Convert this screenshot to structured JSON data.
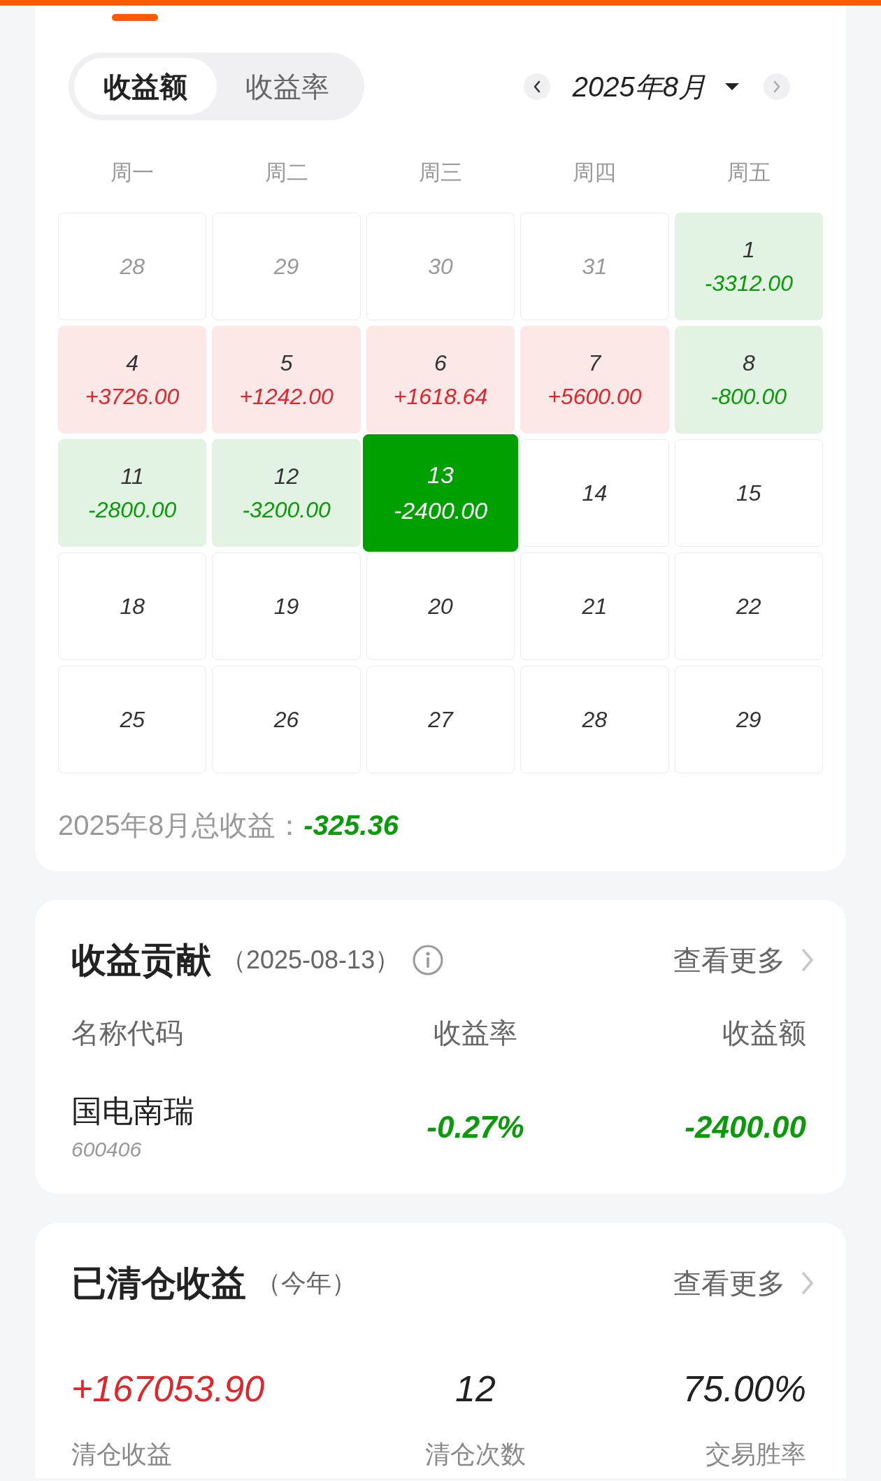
{
  "calendar": {
    "mode_toggle": [
      {
        "label": "收益额",
        "selected": true
      },
      {
        "label": "收益率",
        "selected": false
      }
    ],
    "month_nav": {
      "label": "2025年8月",
      "prev_disabled": false,
      "next_disabled": true
    },
    "weekdays": [
      "周一",
      "周二",
      "周三",
      "周四",
      "周五"
    ],
    "days": [
      {
        "day": "28",
        "outside_month": true,
        "selected": false
      },
      {
        "day": "29",
        "outside_month": true,
        "selected": false
      },
      {
        "day": "30",
        "outside_month": true,
        "selected": false
      },
      {
        "day": "31",
        "outside_month": true,
        "selected": false
      },
      {
        "day": "1",
        "amount": "-3312.00",
        "kind": "loss",
        "outside_month": false,
        "selected": false
      },
      {
        "day": "4",
        "amount": "+3726.00",
        "kind": "gain",
        "outside_month": false,
        "selected": false
      },
      {
        "day": "5",
        "amount": "+1242.00",
        "kind": "gain",
        "outside_month": false,
        "selected": false
      },
      {
        "day": "6",
        "amount": "+1618.64",
        "kind": "gain",
        "outside_month": false,
        "selected": false
      },
      {
        "day": "7",
        "amount": "+5600.00",
        "kind": "gain",
        "outside_month": false,
        "selected": false
      },
      {
        "day": "8",
        "amount": "-800.00",
        "kind": "loss",
        "outside_month": false,
        "selected": false
      },
      {
        "day": "11",
        "amount": "-2800.00",
        "kind": "loss",
        "outside_month": false,
        "selected": false
      },
      {
        "day": "12",
        "amount": "-3200.00",
        "kind": "loss",
        "outside_month": false,
        "selected": false
      },
      {
        "day": "13",
        "amount": "-2400.00",
        "kind": "loss",
        "outside_month": false,
        "selected": true
      },
      {
        "day": "14",
        "outside_month": false,
        "selected": false
      },
      {
        "day": "15",
        "outside_month": false,
        "selected": false
      },
      {
        "day": "18",
        "outside_month": false,
        "selected": false
      },
      {
        "day": "19",
        "outside_month": false,
        "selected": false
      },
      {
        "day": "20",
        "outside_month": false,
        "selected": false
      },
      {
        "day": "21",
        "outside_month": false,
        "selected": false
      },
      {
        "day": "22",
        "outside_month": false,
        "selected": false
      },
      {
        "day": "25",
        "outside_month": false,
        "selected": false
      },
      {
        "day": "26",
        "outside_month": false,
        "selected": false
      },
      {
        "day": "27",
        "outside_month": false,
        "selected": false
      },
      {
        "day": "28",
        "outside_month": false,
        "selected": false
      },
      {
        "day": "29",
        "outside_month": false,
        "selected": false
      }
    ],
    "summary": {
      "label": "2025年8月总收益：",
      "value": "-325.36",
      "negative": true
    }
  },
  "contribution": {
    "title": "收益贡献",
    "date": "（2025-08-13）",
    "more": "查看更多",
    "columns": [
      "名称代码",
      "收益率",
      "收益额"
    ],
    "rows": [
      {
        "name": "国电南瑞",
        "code": "600406",
        "rate": "-0.27%",
        "amount": "-2400.00",
        "negative": true
      }
    ]
  },
  "cleared": {
    "title": "已清仓收益",
    "period": "（今年）",
    "more": "查看更多",
    "stats": [
      {
        "value": "+167053.90",
        "label": "清仓收益",
        "kind": "gain"
      },
      {
        "value": "12",
        "label": "清仓次数",
        "kind": "plain"
      },
      {
        "value": "75.00%",
        "label": "交易胜率",
        "kind": "plain"
      }
    ]
  }
}
